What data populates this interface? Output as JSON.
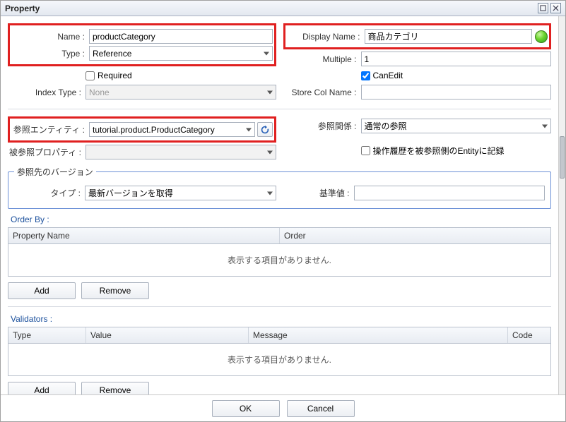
{
  "window": {
    "title": "Property"
  },
  "labels": {
    "name": "Name :",
    "type": "Type :",
    "displayName": "Display Name :",
    "multiple": "Multiple :",
    "required": "Required",
    "canEdit": "CanEdit",
    "indexType": "Index Type :",
    "storeColName": "Store Col Name :",
    "refEntity": "参照エンティティ :",
    "refRelation": "参照関係 :",
    "mappedBy": "被参照プロパティ :",
    "auditLog": "操作履歴を被参照側のEntityに記録",
    "refVersionGroup": "参照先のバージョン",
    "versionType": "タイプ :",
    "baseValue": "基準値 :",
    "orderBy": "Order By :",
    "validators": "Validators :"
  },
  "fields": {
    "name": "productCategory",
    "type": "Reference",
    "displayName": "商品カテゴリ",
    "multiple": "1",
    "required": false,
    "canEdit": true,
    "indexType": "None",
    "storeColName": "",
    "refEntity": "tutorial.product.ProductCategory",
    "refRelation": "通常の参照",
    "mappedBy": "",
    "auditLog": false,
    "versionType": "最新バージョンを取得",
    "baseValue": ""
  },
  "orderBy": {
    "columns": [
      "Property Name",
      "Order"
    ],
    "rows": [],
    "empty": "表示する項目がありません."
  },
  "validators": {
    "columns": [
      "Type",
      "Value",
      "Message",
      "Code"
    ],
    "rows": [],
    "empty": "表示する項目がありません."
  },
  "buttons": {
    "add": "Add",
    "remove": "Remove",
    "ok": "OK",
    "cancel": "Cancel"
  }
}
